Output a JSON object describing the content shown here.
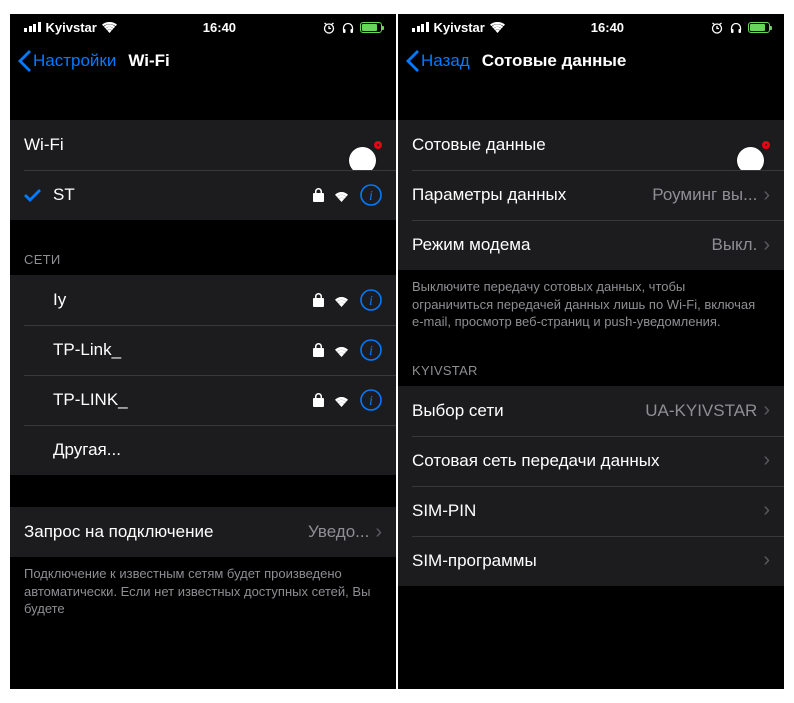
{
  "statusBar": {
    "carrier": "Kyivstar",
    "time": "16:40"
  },
  "left": {
    "back": "Настройки",
    "title": "Wi-Fi",
    "wifiLabel": "Wi-Fi",
    "connectedPrefix": "S",
    "connectedBlurred": "        ",
    "connectedSuffix": "T",
    "networksHeader": "СЕТИ",
    "net1a": "I",
    "net1bBlurred": "       ",
    "net1c": "y",
    "net2a": "TP-Link_",
    "net2bBlurred": "    ",
    "net3a": "TP-LINK_",
    "net3bBlurred": "          ",
    "other": "Другая...",
    "askLabel": "Запрос на подключение",
    "askValue": "Уведо...",
    "footer": "Подключение к известным сетям будет произведено автоматически. Если нет известных доступных сетей, Вы будете"
  },
  "right": {
    "back": "Назад",
    "title": "Сотовые данные",
    "cellLabel": "Сотовые данные",
    "dataOptLabel": "Параметры данных",
    "dataOptValue": "Роуминг вы...",
    "hotspotLabel": "Режим модема",
    "hotspotValue": "Выкл.",
    "footer1": "Выключите передачу сотовых данных, чтобы ограничиться передачей данных лишь по Wi-Fi, включая e-mail, просмотр веб-страниц и push-уведомления.",
    "kyivstarHeader": "KYIVSTAR",
    "netSelLabel": "Выбор сети",
    "netSelValue": "UA-KYIVSTAR",
    "cellNetLabel": "Сотовая сеть передачи данных",
    "simPin": "SIM-PIN",
    "simApps": "SIM-программы"
  }
}
